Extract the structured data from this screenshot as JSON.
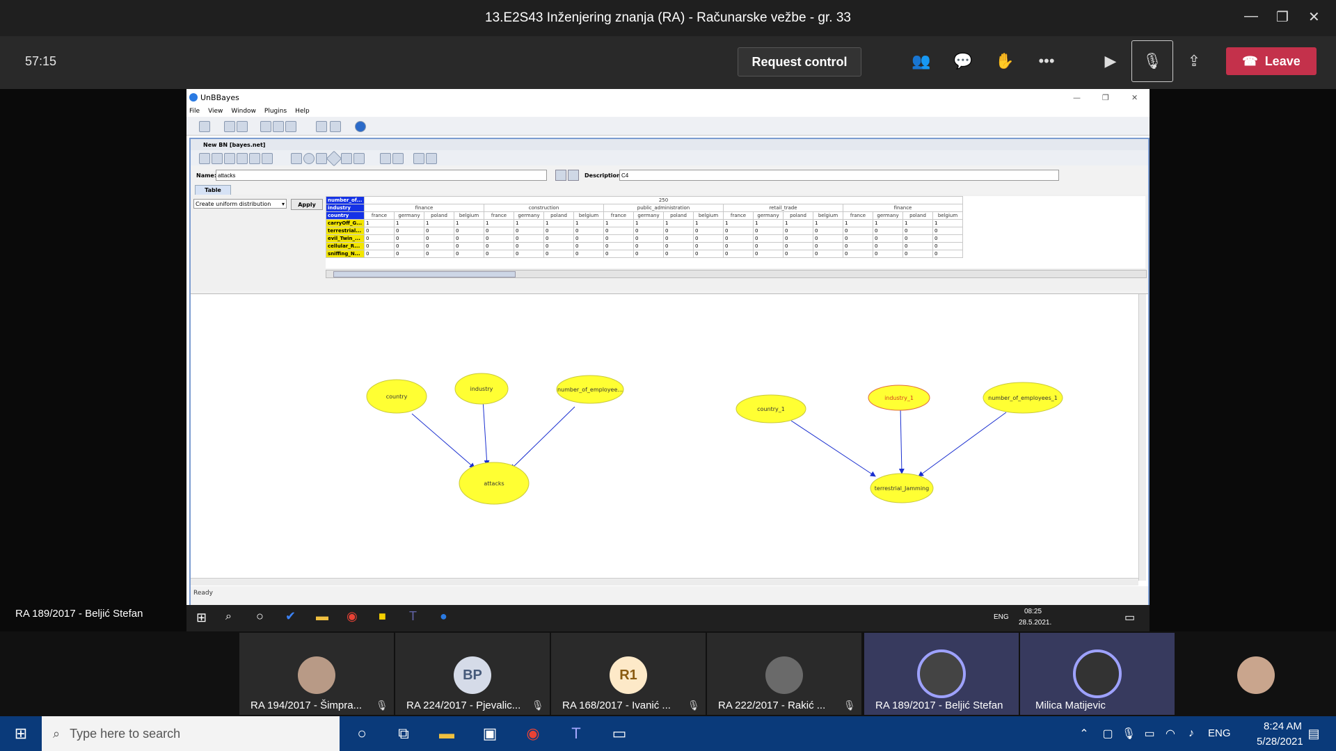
{
  "teams": {
    "meeting_title": "13.E2S43 Inženjering znanja (RA) - Računarske vežbe - gr. 33",
    "timer": "57:15",
    "request_control": "Request control",
    "leave": "Leave",
    "presenter": "RA 189/2017 - Beljić Stefan"
  },
  "app": {
    "title": "UnBBayes",
    "menu": [
      "File",
      "View",
      "Window",
      "Plugins",
      "Help"
    ],
    "inner_title": "New BN [bayes.net]",
    "name_label": "Name:",
    "name_value": "attacks",
    "desc_label": "Description:",
    "desc_value": "C4",
    "tab": "Table",
    "dist_select": "Create uniform distribution",
    "apply": "Apply",
    "status": "Ready",
    "cpt": {
      "row_headers": [
        "number_of...",
        "industry",
        "country"
      ],
      "number_value": "250",
      "industries": [
        "finance",
        "construction",
        "public_administration",
        "retail_trade",
        "finance"
      ],
      "countries": [
        "france",
        "germany",
        "poland",
        "belgium"
      ],
      "states": [
        "carryOff_G...",
        "terrestrial...",
        "evil_Twin_...",
        "cellular_R...",
        "sniffing_N..."
      ],
      "first_row_value": "1",
      "other_value": "0"
    },
    "nodes": [
      "country",
      "industry",
      "number_of_employee...",
      "attacks",
      "country_1",
      "industry_1",
      "number_of_employees_1",
      "terrestrial_Jamming"
    ]
  },
  "desktop_taskbar": {
    "lang": "ENG",
    "time": "08:25",
    "date": "28.5.2021."
  },
  "participants": [
    {
      "name": "RA 194/2017 - Šimpra...",
      "initials": ""
    },
    {
      "name": "RA 224/2017 - Pjevalic...",
      "initials": "BP"
    },
    {
      "name": "RA 168/2017 - Ivanić ...",
      "initials": "R1"
    },
    {
      "name": "RA 222/2017 - Rakić ...",
      "initials": ""
    },
    {
      "name": "RA 189/2017 - Beljić Stefan",
      "initials": ""
    },
    {
      "name": "Milica Matijevic",
      "initials": ""
    }
  ],
  "windows": {
    "search_placeholder": "Type here to search",
    "lang": "ENG",
    "time": "8:24 AM",
    "date": "5/28/2021"
  },
  "colors": {
    "leave": "#c4314b",
    "node_fill": "#ffff33",
    "cpt_header": "#1432e6",
    "cpt_state": "#f3e600"
  }
}
